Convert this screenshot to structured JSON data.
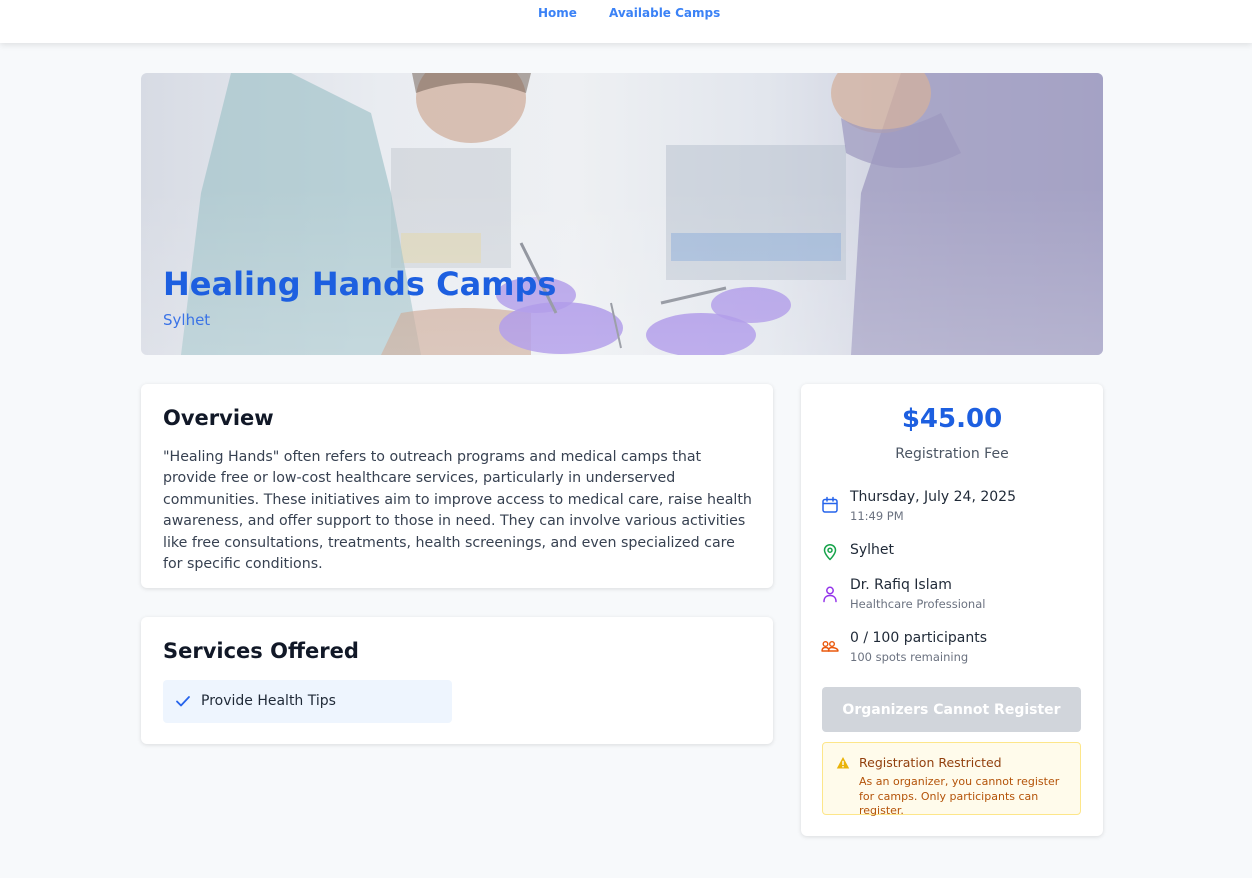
{
  "nav": {
    "links": [
      {
        "label": "Home"
      },
      {
        "label": "Available Camps"
      }
    ]
  },
  "hero": {
    "title": "Healing Hands Camps",
    "location": "Sylhet"
  },
  "overview": {
    "heading": "Overview",
    "body": "\"Healing Hands\" often refers to outreach programs and medical camps that provide free or low-cost healthcare services, particularly in underserved communities. These initiatives aim to improve access to medical care, raise health awareness, and offer support to those in need. They can involve various activities like free consultations, treatments, health screenings, and even specialized care for specific conditions."
  },
  "services": {
    "heading": "Services Offered",
    "items": [
      {
        "label": "Provide Health Tips",
        "icon": "check-icon"
      }
    ]
  },
  "sidebar": {
    "fee": "$45.00",
    "fee_label": "Registration Fee",
    "date": {
      "icon": "calendar-icon",
      "main": "Thursday, July 24, 2025",
      "sub": "11:49 PM"
    },
    "location": {
      "icon": "map-pin-icon",
      "main": "Sylhet"
    },
    "organizer": {
      "icon": "user-icon",
      "main": "Dr. Rafiq Islam",
      "sub": "Healthcare Professional"
    },
    "participants": {
      "icon": "participants-icon",
      "main": "0 / 100 participants",
      "sub": "100 spots remaining"
    },
    "register_button": "Organizers Cannot Register",
    "restriction": {
      "icon": "warning-icon",
      "title": "Registration Restricted",
      "body": "As an organizer, you cannot register for camps. Only participants can register."
    }
  },
  "colors": {
    "accent": "#1d5fe0",
    "nav_link": "#3b82f6",
    "disabled_button": "#d1d5db",
    "warning_bg": "#fffbeb",
    "warning_text": "#92400e"
  }
}
